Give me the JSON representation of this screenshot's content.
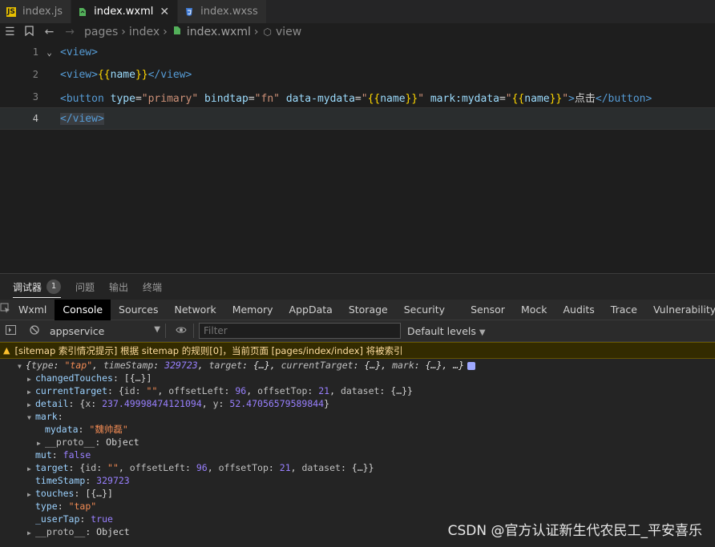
{
  "tabs": [
    {
      "icon": "js-file-icon",
      "glyph": "JS",
      "color": "#e8c000",
      "label": "index.js",
      "active": false
    },
    {
      "icon": "wxml-file-icon",
      "glyph": "",
      "color": "#53b05a",
      "label": "index.wxml",
      "active": true
    },
    {
      "icon": "wxss-file-icon",
      "glyph": "",
      "color": "#3f7bd6",
      "label": "index.wxss",
      "active": false
    }
  ],
  "breadcrumb": {
    "parts": [
      "pages",
      "index",
      "index.wxml",
      "view"
    ]
  },
  "editor": {
    "lines": [
      {
        "num": "1"
      },
      {
        "num": "2"
      },
      {
        "num": "3"
      },
      {
        "num": "4"
      }
    ]
  },
  "panel": {
    "tabs": [
      "调试器",
      "问题",
      "输出",
      "终端"
    ],
    "badge": "1",
    "devtools_tabs": [
      "Wxml",
      "Console",
      "Sources",
      "Network",
      "Memory",
      "AppData",
      "Storage",
      "Security",
      "Sensor",
      "Mock",
      "Audits",
      "Trace",
      "Vulnerability"
    ],
    "context": "appservice",
    "filter_placeholder": "Filter",
    "levels": "Default levels",
    "warning": "[sitemap 索引情况提示] 根据 sitemap 的规则[0]，当前页面 [pages/index/index] 将被索引"
  },
  "colors": {
    "accent": "#569cd6",
    "warning_bg": "#332b00",
    "warning_text": "#ffdd9e"
  },
  "watermark": "CSDN @官方认证新生代农民工_平安喜乐"
}
